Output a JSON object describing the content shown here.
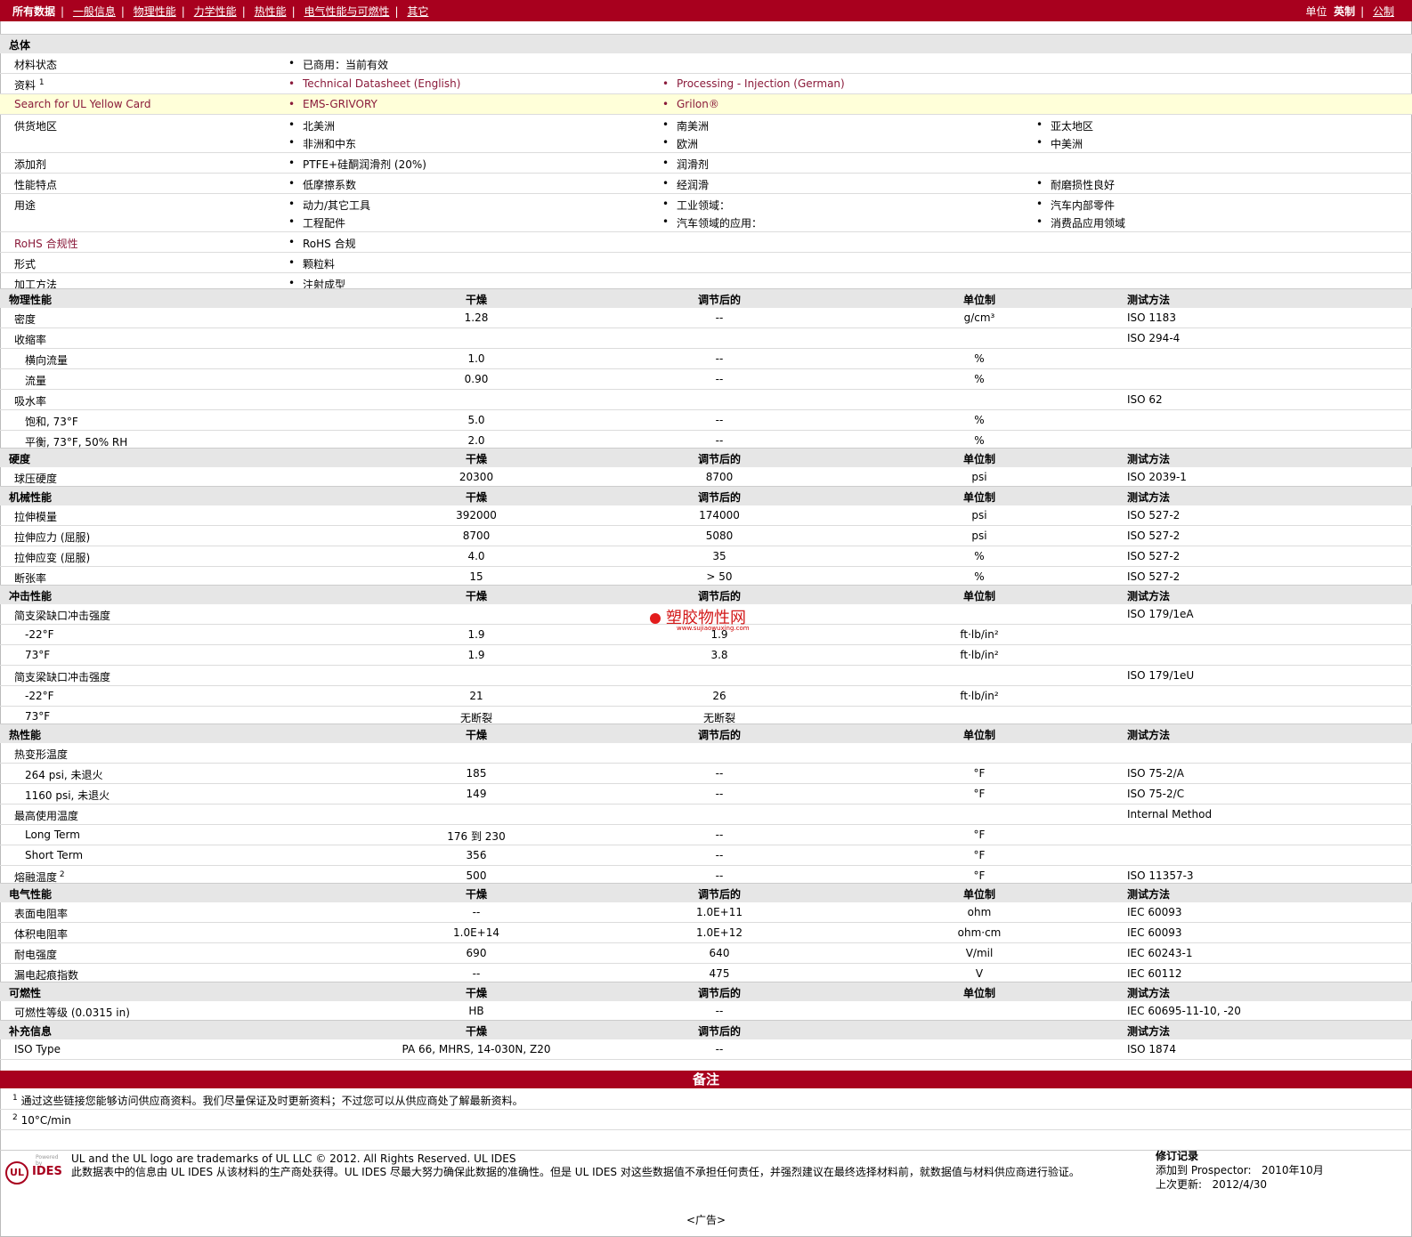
{
  "nav": {
    "all": "所有数据",
    "links": [
      "一般信息",
      "物理性能",
      "力学性能",
      "热性能",
      "电气性能与可燃性",
      "其它"
    ],
    "unit_label": "单位",
    "unit_en": "英制",
    "unit_metric": "公制"
  },
  "general": {
    "title": "总体",
    "status_label": "材料状态",
    "status_value": "已商用：当前有效",
    "doc_label": "资料",
    "doc_sup": "1",
    "doc_1": "Technical Datasheet (English)",
    "doc_2": "Processing - Injection (German)",
    "ul_label": "Search for UL Yellow Card",
    "ul_1": "EMS-GRIVORY",
    "ul_2": "Grilon®",
    "region_label": "供货地区",
    "regions": [
      "北美洲",
      "南美洲",
      "亚太地区",
      "非洲和中东",
      "欧洲",
      "中美洲"
    ],
    "additive_label": "添加剂",
    "additives": [
      "PTFE+硅酮润滑剂 (20%)",
      "润滑剂"
    ],
    "feature_label": "性能特点",
    "features": [
      "低摩擦系数",
      "经润滑",
      "耐磨损性良好"
    ],
    "use_label": "用途",
    "uses": [
      "动力/其它工具",
      "工业领域：",
      "汽车内部零件",
      "工程配件",
      "汽车领域的应用：",
      "消费品应用领域"
    ],
    "rohs_label": "RoHS 合规性",
    "rohs_value": "RoHS 合规",
    "form_label": "形式",
    "form_value": "颗粒料",
    "process_label": "加工方法",
    "process_value": "注射成型"
  },
  "cols": {
    "dry": "干燥",
    "cond": "调节后的",
    "unit": "单位制",
    "method": "测试方法"
  },
  "physical": {
    "title": "物理性能",
    "rows": [
      {
        "name": "密度",
        "indent": false,
        "dry": "1.28",
        "cond": "--",
        "unit": "g/cm³",
        "method": "ISO 1183"
      },
      {
        "name": "收缩率",
        "indent": false,
        "dry": "",
        "cond": "",
        "unit": "",
        "method": "ISO 294-4"
      },
      {
        "name": "横向流量",
        "indent": true,
        "dry": "1.0",
        "cond": "--",
        "unit": "%",
        "method": ""
      },
      {
        "name": "流量",
        "indent": true,
        "dry": "0.90",
        "cond": "--",
        "unit": "%",
        "method": ""
      },
      {
        "name": "吸水率",
        "indent": false,
        "dry": "",
        "cond": "",
        "unit": "",
        "method": "ISO 62"
      },
      {
        "name": "饱和, 73°F",
        "indent": true,
        "dry": "5.0",
        "cond": "--",
        "unit": "%",
        "method": ""
      },
      {
        "name": "平衡, 73°F, 50% RH",
        "indent": true,
        "dry": "2.0",
        "cond": "--",
        "unit": "%",
        "method": ""
      }
    ]
  },
  "hardness": {
    "title": "硬度",
    "rows": [
      {
        "name": "球压硬度",
        "indent": false,
        "dry": "20300",
        "cond": "8700",
        "unit": "psi",
        "method": "ISO 2039-1"
      }
    ]
  },
  "mechanical": {
    "title": "机械性能",
    "rows": [
      {
        "name": "拉伸模量",
        "indent": false,
        "dry": "392000",
        "cond": "174000",
        "unit": "psi",
        "method": "ISO 527-2"
      },
      {
        "name": "拉伸应力 (屈服)",
        "indent": false,
        "dry": "8700",
        "cond": "5080",
        "unit": "psi",
        "method": "ISO 527-2"
      },
      {
        "name": "拉伸应变 (屈服)",
        "indent": false,
        "dry": "4.0",
        "cond": "35",
        "unit": "%",
        "method": "ISO 527-2"
      },
      {
        "name": "断张率",
        "indent": false,
        "dry": "15",
        "cond": "> 50",
        "unit": "%",
        "method": "ISO 527-2"
      }
    ]
  },
  "impact": {
    "title": "冲击性能",
    "rows": [
      {
        "name": "简支梁缺口冲击强度",
        "indent": false,
        "dry": "",
        "cond": "",
        "unit": "",
        "method": "ISO 179/1eA"
      },
      {
        "name": "-22°F",
        "indent": true,
        "dry": "1.9",
        "cond": "1.9",
        "unit": "ft·lb/in²",
        "method": ""
      },
      {
        "name": "73°F",
        "indent": true,
        "dry": "1.9",
        "cond": "3.8",
        "unit": "ft·lb/in²",
        "method": ""
      },
      {
        "name": "简支梁缺口冲击强度",
        "indent": false,
        "dry": "",
        "cond": "",
        "unit": "",
        "method": "ISO 179/1eU"
      },
      {
        "name": "-22°F",
        "indent": true,
        "dry": "21",
        "cond": "26",
        "unit": "ft·lb/in²",
        "method": ""
      },
      {
        "name": "73°F",
        "indent": true,
        "dry": "无断裂",
        "cond": "无断裂",
        "unit": "",
        "method": ""
      }
    ]
  },
  "thermal": {
    "title": "热性能",
    "rows": [
      {
        "name": "热变形温度",
        "indent": false,
        "dry": "",
        "cond": "",
        "unit": "",
        "method": ""
      },
      {
        "name": "264 psi, 未退火",
        "indent": true,
        "dry": "185",
        "cond": "--",
        "unit": "°F",
        "method": "ISO 75-2/A"
      },
      {
        "name": "1160 psi, 未退火",
        "indent": true,
        "dry": "149",
        "cond": "--",
        "unit": "°F",
        "method": "ISO 75-2/C"
      },
      {
        "name": "最高使用温度",
        "indent": false,
        "dry": "",
        "cond": "",
        "unit": "",
        "method": "Internal Method"
      },
      {
        "name": "Long Term",
        "indent": true,
        "dry": "176 到  230",
        "cond": "--",
        "unit": "°F",
        "method": ""
      },
      {
        "name": "Short Term",
        "indent": true,
        "dry": "356",
        "cond": "--",
        "unit": "°F",
        "method": ""
      },
      {
        "name": "熔融温度",
        "sup": "2",
        "indent": false,
        "dry": "500",
        "cond": "--",
        "unit": "°F",
        "method": "ISO 11357-3"
      }
    ]
  },
  "electrical": {
    "title": "电气性能",
    "rows": [
      {
        "name": "表面电阻率",
        "indent": false,
        "dry": "--",
        "cond": "1.0E+11",
        "unit": "ohm",
        "method": "IEC 60093"
      },
      {
        "name": "体积电阻率",
        "indent": false,
        "dry": "1.0E+14",
        "cond": "1.0E+12",
        "unit": "ohm·cm",
        "method": "IEC 60093"
      },
      {
        "name": "耐电强度",
        "indent": false,
        "dry": "690",
        "cond": "640",
        "unit": "V/mil",
        "method": "IEC 60243-1"
      },
      {
        "name": "漏电起痕指数",
        "indent": false,
        "dry": "--",
        "cond": "475",
        "unit": "V",
        "method": "IEC 60112"
      }
    ]
  },
  "flammability": {
    "title": "可燃性",
    "rows": [
      {
        "name": "可燃性等级 (0.0315 in)",
        "indent": false,
        "dry": "HB",
        "cond": "--",
        "unit": "",
        "method": "IEC 60695-11-10, -20"
      }
    ]
  },
  "supplement": {
    "title": "补充信息",
    "rows": [
      {
        "name": "ISO Type",
        "indent": false,
        "dry": "PA 66, MHRS, 14-030N, Z20",
        "cond": "--",
        "unit": "",
        "method": "ISO 1874"
      }
    ]
  },
  "notes": {
    "title": "备注",
    "n1_sup": "1",
    "n1": "通过这些链接您能够访问供应商资料。我们尽量保证及时更新资料；不过您可以从供应商处了解最新资料。",
    "n2_sup": "2",
    "n2": "10°C/min"
  },
  "footer": {
    "logo_small": "Powered by",
    "logo_ul": "UL",
    "logo_ides": "IDES",
    "line1": "UL and the UL logo are trademarks of UL LLC © 2012. All Rights Reserved. UL IDES",
    "line2": "此数据表中的信息由  UL IDES 从该材料的生产商处获得。UL IDES 尽最大努力确保此数据的准确性。但是  UL IDES 对这些数据值不承担任何责任，并强烈建议在最终选择材料前，就数据值与材料供应商进行验证。",
    "rev_title": "修订记录",
    "rev_added_label": "添加到  Prospector:",
    "rev_added_value": "2010年10月",
    "rev_updated_label": "上次更新:",
    "rev_updated_value": "2012/4/30",
    "ad": "<广告>"
  },
  "watermark": {
    "text": "塑胶物性网",
    "url": "www.sujiaowuxing.com"
  }
}
